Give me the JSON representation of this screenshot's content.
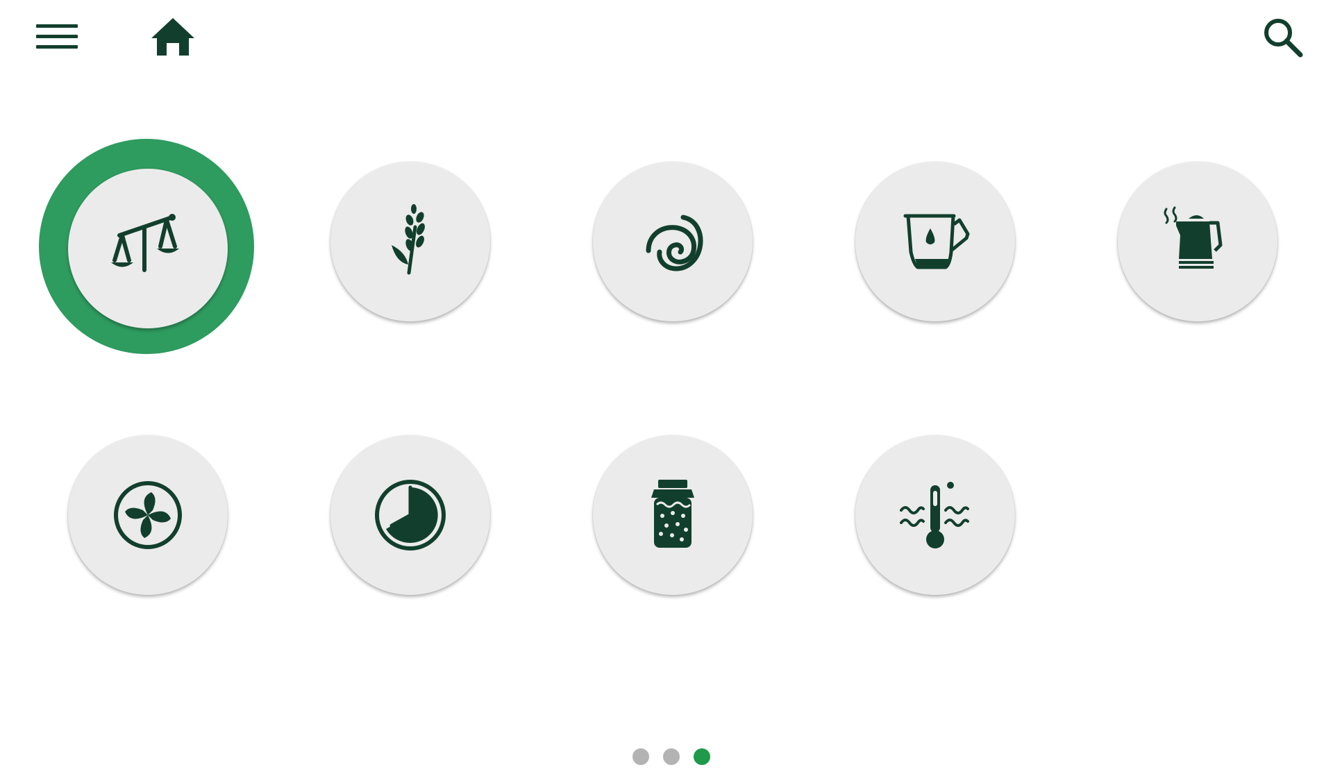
{
  "header": {
    "menu_icon": "hamburger-menu-icon",
    "home_icon": "home-icon",
    "search_icon": "search-icon"
  },
  "program_tiles": [
    {
      "icon": "scale-icon",
      "selected": true
    },
    {
      "icon": "wheat-icon",
      "selected": false
    },
    {
      "icon": "dough-spiral-icon",
      "selected": false
    },
    {
      "icon": "jug-water-drop-icon",
      "selected": false
    },
    {
      "icon": "kettle-icon",
      "selected": false
    },
    {
      "icon": "turbo-fan-icon",
      "selected": false
    },
    {
      "icon": "timer-clock-icon",
      "selected": false
    },
    {
      "icon": "jam-jar-icon",
      "selected": false
    },
    {
      "icon": "thermometer-heat-icon",
      "selected": false
    }
  ],
  "pagination": {
    "pages": 3,
    "current_page": 3
  },
  "colors": {
    "icon": "#123f2d",
    "selected_ring": "#2e9b5f",
    "tile_background": "#ebebeb",
    "dot_active": "#1f9a4a",
    "dot_inactive": "#b3b3b3"
  }
}
